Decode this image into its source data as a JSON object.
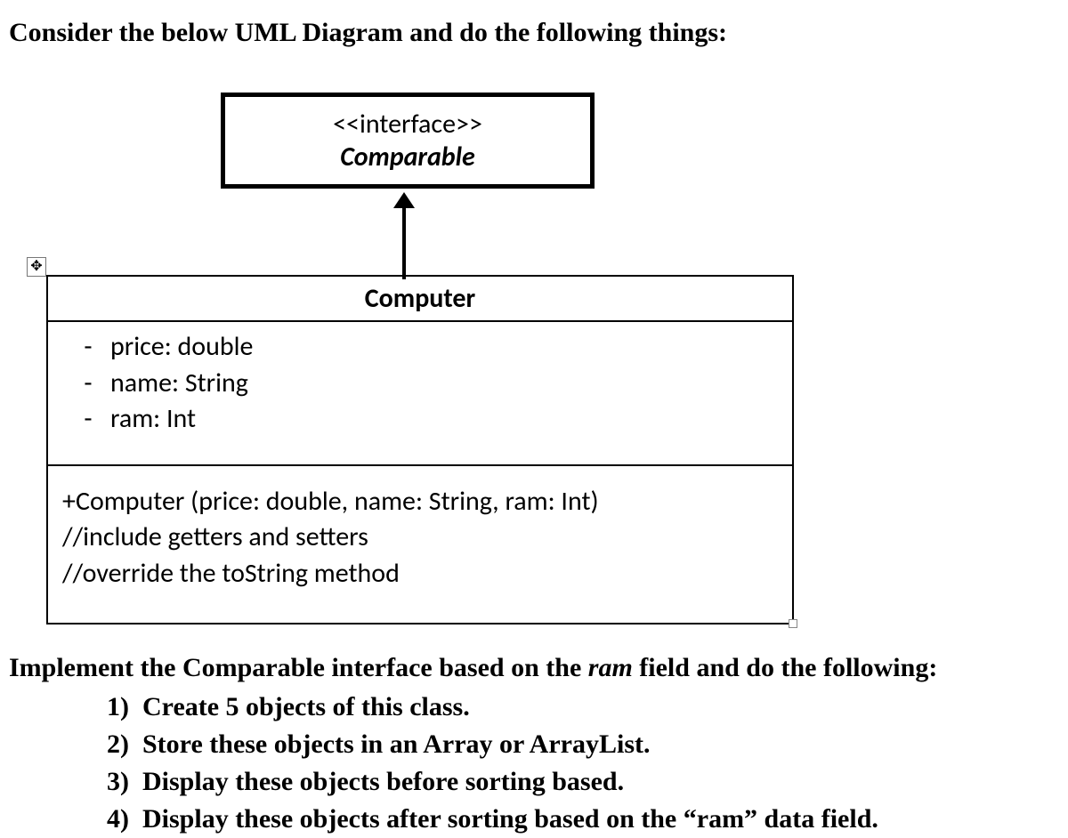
{
  "heading": "Consider the below UML Diagram and do the following things:",
  "uml": {
    "interface": {
      "stereotype": "<<interface>>",
      "name": "Comparable"
    },
    "class": {
      "name": "Computer",
      "attributes": [
        {
          "vis": "-",
          "text": "price: double"
        },
        {
          "vis": "-",
          "text": "name: String"
        },
        {
          "vis": "-",
          "text": "ram: Int"
        }
      ],
      "methods": [
        "+Computer (price: double, name: String, ram: Int)",
        "//include getters and setters",
        "//override the toString method"
      ]
    },
    "move_handle_glyph": "✥"
  },
  "instructions": {
    "lead_pre": "Implement the Comparable interface based on the ",
    "lead_em": "ram",
    "lead_post": " field and do the following:",
    "items": [
      "Create 5 objects of this class.",
      "Store these objects in an Array or ArrayList.",
      "Display these objects before sorting based.",
      "Display these objects after sorting based on the “ram” data field."
    ]
  }
}
